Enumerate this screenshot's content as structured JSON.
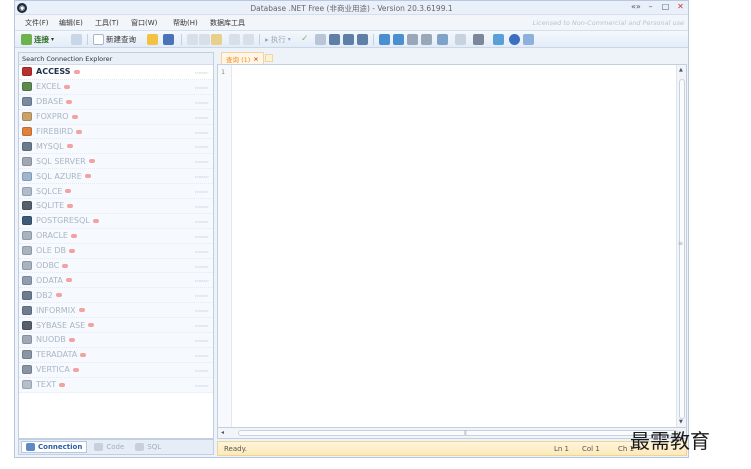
{
  "window": {
    "title": "Database .NET Free (非商业用途) - Version 20.3.6199.1",
    "license_note": "Licensed to Non-Commercial and Personal use",
    "controls": [
      "«»",
      "–",
      "□",
      "✕"
    ]
  },
  "menu": {
    "items": [
      "文件(F)",
      "编辑(E)",
      "工具(T)",
      "窗口(W)",
      "帮助(H)",
      "数据库工具"
    ]
  },
  "toolbar": {
    "connect_label": "连接",
    "new_query_label": "新建查询",
    "execute_label": "执行"
  },
  "explorer": {
    "header": "Search Connection Explorer",
    "hint": "<none>",
    "items": [
      {
        "label": "ACCESS",
        "icon": "access-icon",
        "color": "#b8312f"
      },
      {
        "label": "EXCEL",
        "icon": "excel-icon",
        "color": "#5c8a4c"
      },
      {
        "label": "DBASE",
        "icon": "dbase-icon",
        "color": "#7a8aa0"
      },
      {
        "label": "FOXPRO",
        "icon": "foxpro-icon",
        "color": "#c9a26a"
      },
      {
        "label": "FIREBIRD",
        "icon": "firebird-icon",
        "color": "#e0803a"
      },
      {
        "label": "MYSQL",
        "icon": "mysql-icon",
        "color": "#6b7b8c"
      },
      {
        "label": "SQL SERVER",
        "icon": "sqlserver-icon",
        "color": "#a0a8b4"
      },
      {
        "label": "SQL AZURE",
        "icon": "sqlazure-icon",
        "color": "#9fb6d1"
      },
      {
        "label": "SQLCE",
        "icon": "sqlce-icon",
        "color": "#b0bcc9"
      },
      {
        "label": "SQLITE",
        "icon": "sqlite-icon",
        "color": "#55606b"
      },
      {
        "label": "POSTGRESQL",
        "icon": "postgresql-icon",
        "color": "#3c5a7a"
      },
      {
        "label": "ORACLE",
        "icon": "oracle-icon",
        "color": "#a8b3c0"
      },
      {
        "label": "OLE DB",
        "icon": "oledb-icon",
        "color": "#a8b3c0"
      },
      {
        "label": "ODBC",
        "icon": "odbc-icon",
        "color": "#a8b3c0"
      },
      {
        "label": "ODATA",
        "icon": "odata-icon",
        "color": "#8f9eaf"
      },
      {
        "label": "DB2",
        "icon": "db2-icon",
        "color": "#6d7d8f"
      },
      {
        "label": "INFORMIX",
        "icon": "informix-icon",
        "color": "#6d7d8f"
      },
      {
        "label": "SYBASE ASE",
        "icon": "sybase-icon",
        "color": "#55606b"
      },
      {
        "label": "NUODB",
        "icon": "nuodb-icon",
        "color": "#a0aab6"
      },
      {
        "label": "TERADATA",
        "icon": "teradata-icon",
        "color": "#8a95a3"
      },
      {
        "label": "VERTICA",
        "icon": "vertica-icon",
        "color": "#8a95a3"
      },
      {
        "label": "TEXT",
        "icon": "text-icon",
        "color": "#b5bfcb"
      }
    ]
  },
  "bottom_tabs": [
    {
      "label": "Connection",
      "icon": "connection-icon",
      "active": true
    },
    {
      "label": "Code",
      "icon": "code-icon",
      "active": false
    },
    {
      "label": "SQL",
      "icon": "sql-icon",
      "active": false
    }
  ],
  "editor": {
    "tab_label": "查询 (1)",
    "tab_close": "×",
    "line_numbers": [
      "1"
    ],
    "scroll_grip": "≡"
  },
  "status": {
    "ready": "Ready.",
    "line": "Ln 1",
    "col": "Col 1",
    "ch": "Ch 1"
  },
  "watermark": "最需教育"
}
